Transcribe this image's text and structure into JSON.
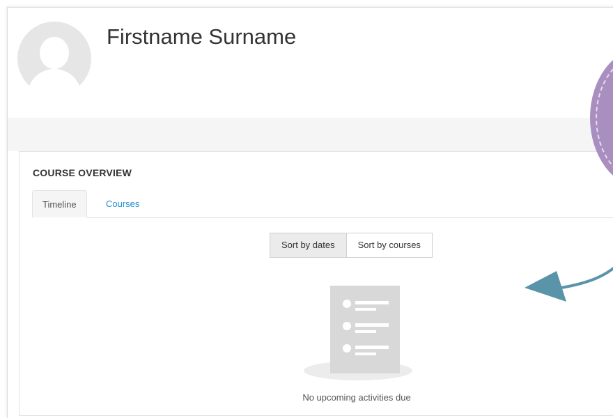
{
  "profile": {
    "name": "Firstname Surname"
  },
  "course_overview": {
    "title": "COURSE OVERVIEW",
    "tabs": [
      {
        "label": "Timeline",
        "active": true
      },
      {
        "label": "Courses",
        "active": false
      }
    ],
    "sort_buttons": [
      {
        "label": "Sort by dates",
        "active": true
      },
      {
        "label": "Sort by courses",
        "active": false
      }
    ],
    "empty_state_text": "No upcoming activities due"
  },
  "icons": {
    "avatar": "user-avatar-placeholder",
    "empty_state": "list-document-icon",
    "annotation_arrow": "arrow-annotation-icon",
    "decoration": "purple-badge-decoration"
  },
  "colors": {
    "link": "#1f8fd0",
    "annotation_arrow": "#5a94a8",
    "decoration": "#a98fc0",
    "illustration": "#d8d8d8"
  }
}
